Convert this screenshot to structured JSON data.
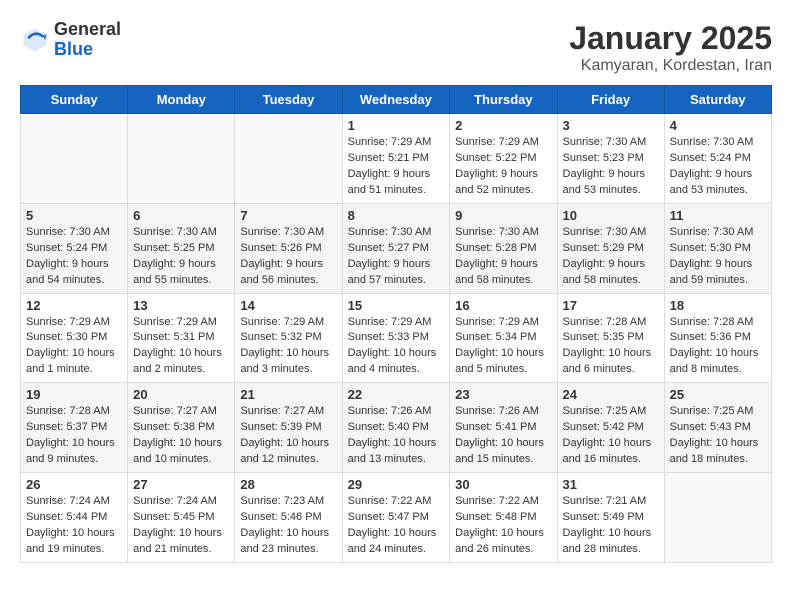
{
  "header": {
    "logo_general": "General",
    "logo_blue": "Blue",
    "month": "January 2025",
    "location": "Kamyaran, Kordestan, Iran"
  },
  "weekdays": [
    "Sunday",
    "Monday",
    "Tuesday",
    "Wednesday",
    "Thursday",
    "Friday",
    "Saturday"
  ],
  "weeks": [
    [
      {
        "day": "",
        "info": ""
      },
      {
        "day": "",
        "info": ""
      },
      {
        "day": "",
        "info": ""
      },
      {
        "day": "1",
        "info": "Sunrise: 7:29 AM\nSunset: 5:21 PM\nDaylight: 9 hours\nand 51 minutes."
      },
      {
        "day": "2",
        "info": "Sunrise: 7:29 AM\nSunset: 5:22 PM\nDaylight: 9 hours\nand 52 minutes."
      },
      {
        "day": "3",
        "info": "Sunrise: 7:30 AM\nSunset: 5:23 PM\nDaylight: 9 hours\nand 53 minutes."
      },
      {
        "day": "4",
        "info": "Sunrise: 7:30 AM\nSunset: 5:24 PM\nDaylight: 9 hours\nand 53 minutes."
      }
    ],
    [
      {
        "day": "5",
        "info": "Sunrise: 7:30 AM\nSunset: 5:24 PM\nDaylight: 9 hours\nand 54 minutes."
      },
      {
        "day": "6",
        "info": "Sunrise: 7:30 AM\nSunset: 5:25 PM\nDaylight: 9 hours\nand 55 minutes."
      },
      {
        "day": "7",
        "info": "Sunrise: 7:30 AM\nSunset: 5:26 PM\nDaylight: 9 hours\nand 56 minutes."
      },
      {
        "day": "8",
        "info": "Sunrise: 7:30 AM\nSunset: 5:27 PM\nDaylight: 9 hours\nand 57 minutes."
      },
      {
        "day": "9",
        "info": "Sunrise: 7:30 AM\nSunset: 5:28 PM\nDaylight: 9 hours\nand 58 minutes."
      },
      {
        "day": "10",
        "info": "Sunrise: 7:30 AM\nSunset: 5:29 PM\nDaylight: 9 hours\nand 58 minutes."
      },
      {
        "day": "11",
        "info": "Sunrise: 7:30 AM\nSunset: 5:30 PM\nDaylight: 9 hours\nand 59 minutes."
      }
    ],
    [
      {
        "day": "12",
        "info": "Sunrise: 7:29 AM\nSunset: 5:30 PM\nDaylight: 10 hours\nand 1 minute."
      },
      {
        "day": "13",
        "info": "Sunrise: 7:29 AM\nSunset: 5:31 PM\nDaylight: 10 hours\nand 2 minutes."
      },
      {
        "day": "14",
        "info": "Sunrise: 7:29 AM\nSunset: 5:32 PM\nDaylight: 10 hours\nand 3 minutes."
      },
      {
        "day": "15",
        "info": "Sunrise: 7:29 AM\nSunset: 5:33 PM\nDaylight: 10 hours\nand 4 minutes."
      },
      {
        "day": "16",
        "info": "Sunrise: 7:29 AM\nSunset: 5:34 PM\nDaylight: 10 hours\nand 5 minutes."
      },
      {
        "day": "17",
        "info": "Sunrise: 7:28 AM\nSunset: 5:35 PM\nDaylight: 10 hours\nand 6 minutes."
      },
      {
        "day": "18",
        "info": "Sunrise: 7:28 AM\nSunset: 5:36 PM\nDaylight: 10 hours\nand 8 minutes."
      }
    ],
    [
      {
        "day": "19",
        "info": "Sunrise: 7:28 AM\nSunset: 5:37 PM\nDaylight: 10 hours\nand 9 minutes."
      },
      {
        "day": "20",
        "info": "Sunrise: 7:27 AM\nSunset: 5:38 PM\nDaylight: 10 hours\nand 10 minutes."
      },
      {
        "day": "21",
        "info": "Sunrise: 7:27 AM\nSunset: 5:39 PM\nDaylight: 10 hours\nand 12 minutes."
      },
      {
        "day": "22",
        "info": "Sunrise: 7:26 AM\nSunset: 5:40 PM\nDaylight: 10 hours\nand 13 minutes."
      },
      {
        "day": "23",
        "info": "Sunrise: 7:26 AM\nSunset: 5:41 PM\nDaylight: 10 hours\nand 15 minutes."
      },
      {
        "day": "24",
        "info": "Sunrise: 7:25 AM\nSunset: 5:42 PM\nDaylight: 10 hours\nand 16 minutes."
      },
      {
        "day": "25",
        "info": "Sunrise: 7:25 AM\nSunset: 5:43 PM\nDaylight: 10 hours\nand 18 minutes."
      }
    ],
    [
      {
        "day": "26",
        "info": "Sunrise: 7:24 AM\nSunset: 5:44 PM\nDaylight: 10 hours\nand 19 minutes."
      },
      {
        "day": "27",
        "info": "Sunrise: 7:24 AM\nSunset: 5:45 PM\nDaylight: 10 hours\nand 21 minutes."
      },
      {
        "day": "28",
        "info": "Sunrise: 7:23 AM\nSunset: 5:46 PM\nDaylight: 10 hours\nand 23 minutes."
      },
      {
        "day": "29",
        "info": "Sunrise: 7:22 AM\nSunset: 5:47 PM\nDaylight: 10 hours\nand 24 minutes."
      },
      {
        "day": "30",
        "info": "Sunrise: 7:22 AM\nSunset: 5:48 PM\nDaylight: 10 hours\nand 26 minutes."
      },
      {
        "day": "31",
        "info": "Sunrise: 7:21 AM\nSunset: 5:49 PM\nDaylight: 10 hours\nand 28 minutes."
      },
      {
        "day": "",
        "info": ""
      }
    ]
  ]
}
